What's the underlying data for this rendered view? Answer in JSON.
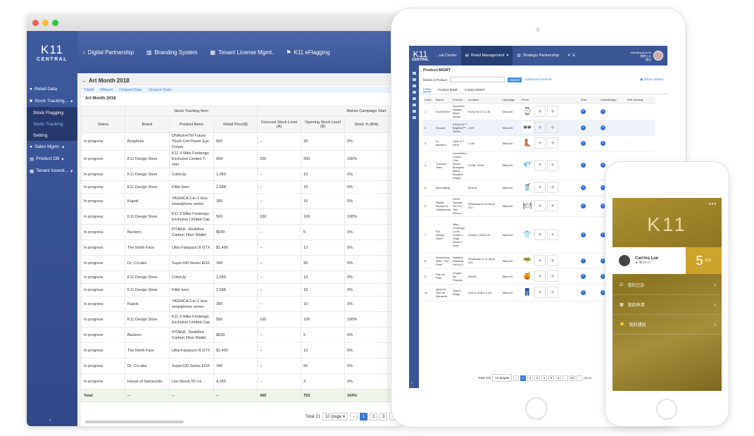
{
  "colors": {
    "sidebar": "#3c5a9d",
    "accent": "#3a7bd5",
    "phone_gold": "#cda42b"
  },
  "desktop": {
    "logo": {
      "top": "K11",
      "bottom": "CENTRAL"
    },
    "topnav": [
      {
        "label": "Digital Partnership",
        "icon": "chevron-left-icon"
      },
      {
        "label": "Branding System",
        "icon": "chart-icon"
      },
      {
        "label": "Tenant License Mgmt.",
        "icon": "building-icon"
      },
      {
        "label": "K11 eFlagging",
        "icon": "flag-icon"
      }
    ],
    "sidebar": [
      {
        "label": "Retail Data"
      },
      {
        "label": "Stock Tracking..."
      },
      {
        "label": "Stock Flagging"
      },
      {
        "label": "Stock Tracking"
      },
      {
        "label": "Setting"
      },
      {
        "label": "Sales Mgmt."
      },
      {
        "label": "Product DB"
      },
      {
        "label": "Tenant Incenti..."
      }
    ],
    "page_title": "Art Month 2018",
    "toolbar": {
      "edit": "Edit",
      "reset": "Reset",
      "import": "Import Data",
      "export": "Export Data"
    },
    "section_title": "Art Month 2018",
    "group_headers": {
      "stock": "Stock Tracking Item",
      "before": "Before Campaign Start"
    },
    "columns": [
      "Status",
      "Brand",
      "Product Items",
      "Retail Price($)",
      "Forecast Stock Level (A)",
      "Opening Stock Level (B)",
      "Stock % (B/A)"
    ],
    "rows": [
      [
        "In progress",
        "Borghese",
        "DNActiveTM Future Youth Cell Power Eye Cream",
        "800",
        "--",
        "30",
        "0%"
      ],
      [
        "In progress",
        "K11 Design Store",
        "K11 X Mike Fredengo Exclusive Limited T-shirt",
        "699",
        "200",
        "200",
        "100%"
      ],
      [
        "In progress",
        "K11 Design Store",
        "ColorUp",
        "1,099",
        "--",
        "10",
        "0%"
      ],
      [
        "In progress",
        "K11 Design Store",
        "Fitbit Ionic",
        "2,598",
        "--",
        "15",
        "0%"
      ],
      [
        "In progress",
        "Kapok",
        "YASHICA 2-in-1 lens smartphone series",
        "390",
        "--",
        "10",
        "0%"
      ],
      [
        "In progress",
        "K11 Design Store",
        "K11 X Mike Fredengo Exclusive Limited Cap",
        "560",
        "100",
        "100",
        "100%"
      ],
      [
        "In progress",
        "Backers",
        "PITAKA - Redefine Carbon Fiber Wallet",
        "$639",
        "--",
        "5",
        "0%"
      ],
      [
        "In progress",
        "The North Face",
        "Ultra Fastpack III GTX",
        "$1,490",
        "--",
        "12",
        "0%"
      ],
      [
        "In progress",
        "Dr. Ci:Labo",
        "Super100 Series EGF",
        "340",
        "--",
        "95",
        "0%"
      ],
      [
        "In progress",
        "K11 Design Store",
        "ColorUp",
        "1,099",
        "--",
        "10",
        "0%"
      ],
      [
        "In progress",
        "K11 Design Store",
        "Fitbit Ionic",
        "2,598",
        "--",
        "15",
        "0%"
      ],
      [
        "In progress",
        "Kapok",
        "YASHICA 2-in-1 lens smartphone series",
        "390",
        "--",
        "10",
        "0%"
      ],
      [
        "In progress",
        "K11 Design Store",
        "K11 X Mike Fredengo Exclusive Limited Cap",
        "560",
        "100",
        "100",
        "100%"
      ],
      [
        "In progress",
        "Backers",
        "PITAKA - Redefine Carbon Fiber Wallet",
        "$639",
        "--",
        "5",
        "0%"
      ],
      [
        "In progress",
        "The North Face",
        "Ultra Fastpack III GTX",
        "$1,490",
        "--",
        "12",
        "0%"
      ],
      [
        "In progress",
        "Dr. Ci:Labo",
        "Super100 Series EGF",
        "340",
        "--",
        "95",
        "0%"
      ],
      [
        "In progress",
        "House of Samsonite",
        "Lite-Shock 55 cm",
        "4,350",
        "--",
        "3",
        "0%"
      ]
    ],
    "total": [
      "Total",
      "--",
      "--",
      "--",
      "460",
      "753",
      "164%"
    ],
    "pagination": {
      "total": "Total 21",
      "page_size": "10 /page",
      "pages": [
        "1",
        "2",
        "3"
      ]
    }
  },
  "tablet": {
    "logo": {
      "top": "K11",
      "bottom": "CENTRAL"
    },
    "tabs": [
      "...val Center",
      "Retail Management",
      "Strategic Partnership",
      "E"
    ],
    "user": {
      "line1": "hello@sujima.hk",
      "line2": "香港 K11",
      "line3": "登出"
    },
    "title": "Product MGMT",
    "search": {
      "label": "Brand or Product",
      "button": "Search",
      "advanced": "Advanced Search",
      "upload": "Photo Upload"
    },
    "subtabs": [
      "Index",
      "Product detail",
      "Activity MGMT"
    ],
    "columns": [
      "Index",
      "Brand",
      "Product ...",
      "Location",
      "Campaign",
      "Photo",
      "iPad",
      "Website/App",
      "Wifi Landing"
    ],
    "rows": [
      [
        "1",
        "KLASSE14",
        "Imperfect Square Black 40mm",
        "Kiosk No 07 & 38",
        "Tattoo16",
        "⌚"
      ],
      [
        "2",
        "Kinsole",
        "KINSOLE™ Brightful™ Series",
        "L307",
        "Tattoo16",
        "🕶"
      ],
      [
        "3",
        "Dr. Martens",
        "1460 Q 7 ASIA",
        "L106",
        "Tattoo16",
        "👢"
      ],
      [
        "4",
        "Thomas Sabo",
        "Generation Charm Club Series Multigem Black Sesame Shape",
        "G15B, G16A",
        "Tattoo16",
        "💎"
      ],
      [
        "5",
        "Baremilling",
        "",
        "B101A",
        "Tattoo16",
        "🥤"
      ],
      [
        "6",
        "Pause Reward & Pastforward",
        "ZHIXI Special Set For Two Person",
        "Restaurant 2 of Shop 201",
        "Tattoo16",
        "🍽"
      ],
      [
        "7",
        "K11 Design Store",
        "Mike Fredengo Louis Vuitton x Virgil Abloh T-Shirt",
        "L505A,L706A,111",
        "Tattoo16",
        "👕"
      ],
      [
        "8",
        "Something Wild - The Farm",
        "Nutrition Rainbow Set for 2",
        "Restaurant 1 of Shop 201",
        "Tattoo16",
        "🥗"
      ],
      [
        "9",
        "Pan de Pain",
        "Kougel No Shizuku",
        "B111B",
        "Tattoo16",
        "🍯"
      ],
      [
        "10",
        "agnes b. Rue de Marseille",
        "Jean's Kingo",
        "G26 & G28 & L110",
        "Tattoo16",
        "👖"
      ]
    ],
    "pagination": {
      "total": "Total 232",
      "page_size": "10 /page",
      "pages": [
        "1",
        "2",
        "3",
        "4",
        "5",
        "6",
        "...",
        "24"
      ],
      "goto": "Go to"
    }
  },
  "phone": {
    "logo": "K11",
    "user_name": "Carrins Lee",
    "user_sub": "★ 關注K11",
    "points": "5",
    "points_unit": "积分",
    "items": [
      {
        "label": "我的已办",
        "icon": "check-doc-icon"
      },
      {
        "label": "我的申请",
        "icon": "calendar-icon"
      },
      {
        "label": "我的通知",
        "icon": "bell-icon"
      }
    ]
  }
}
